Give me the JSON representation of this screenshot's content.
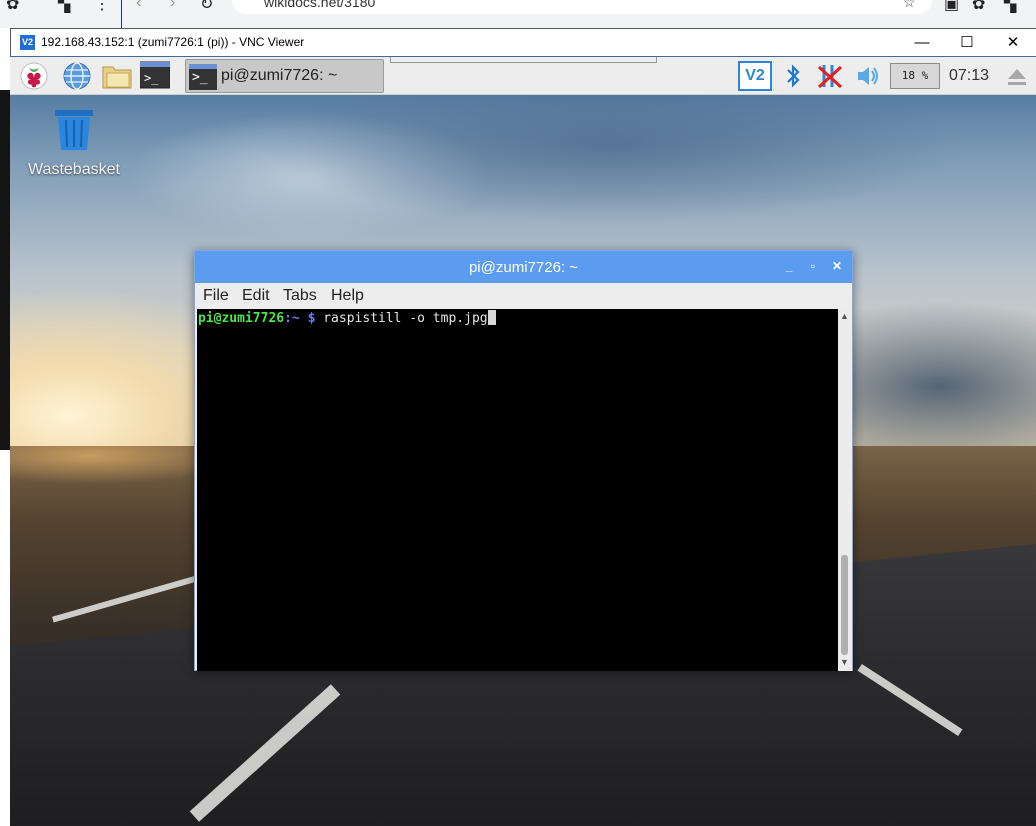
{
  "browser": {
    "url": "wikidocs.net/3180"
  },
  "vnc": {
    "title": "192.168.43.152:1 (zumi7726:1 (pi)) - VNC Viewer",
    "logo": "V2",
    "minimize": "—",
    "maximize": "☐",
    "close": "✕"
  },
  "taskbar": {
    "launchers": [
      {
        "name": "raspberry-menu-icon"
      },
      {
        "name": "web-browser-icon"
      },
      {
        "name": "file-manager-icon"
      },
      {
        "name": "terminal-launcher-icon"
      }
    ],
    "active_task": {
      "label": "pi@zumi7726: ~",
      "icon_glyph": ">_"
    },
    "tray": {
      "vnc_icon": "V2",
      "bluetooth_icon": "bluetooth-icon",
      "network_icon": "network-disconnected-icon",
      "volume_icon": "volume-icon",
      "cpu": "18 %",
      "clock": "07:13",
      "eject_icon": "eject-icon"
    }
  },
  "desktop": {
    "icons": [
      {
        "label": "Wastebasket"
      }
    ]
  },
  "terminal": {
    "title": "pi@zumi7726: ~",
    "menu": [
      "File",
      "Edit",
      "Tabs",
      "Help"
    ],
    "prompt_user": "pi@zumi7726",
    "prompt_path": ":~ $",
    "command": " raspistill -o tmp.jpg"
  },
  "colors": {
    "title_blue": "#5b9cf0",
    "prompt_green": "#4ee44e",
    "prompt_blue": "#6b7cf2"
  }
}
